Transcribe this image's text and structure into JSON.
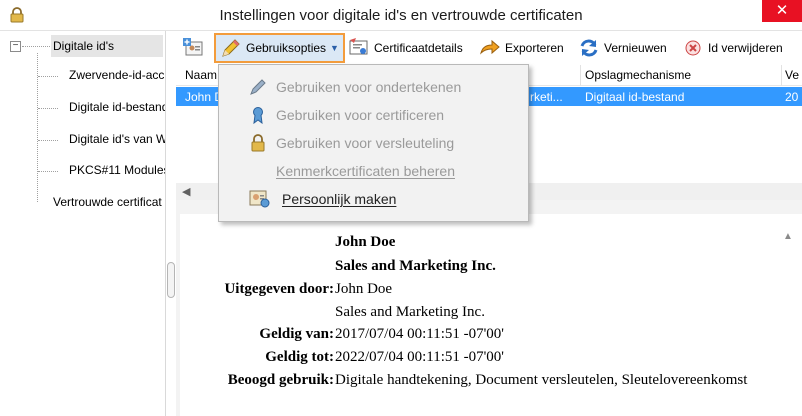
{
  "window": {
    "title": "Instellingen voor digitale id's en vertrouwde certificaten",
    "close_label": "✕"
  },
  "tree": {
    "toggle": "−",
    "root": "Digitale id's",
    "children": [
      "Zwervende-id-acc",
      "Digitale id-bestand",
      "Digitale id's van W",
      "PKCS#11 Modules"
    ],
    "trusted": "Vertrouwde certificat"
  },
  "toolbar": {
    "use_options": "Gebruiksopties",
    "cert_details": "Certificaatdetails",
    "export": "Exporteren",
    "refresh": "Vernieuwen",
    "remove_id": "Id verwijderen"
  },
  "table": {
    "columns": [
      "Naam",
      "Opslagmechanisme",
      "Ve"
    ],
    "row": {
      "name": "John D",
      "issuer_fragment": "rketi...",
      "storage": "Digitaal id-bestand",
      "version": "20"
    }
  },
  "menu": {
    "items": [
      {
        "label": "Gebruiken voor ondertekenen",
        "icon": "pen-icon",
        "enabled": false
      },
      {
        "label": "Gebruiken voor certificeren",
        "icon": "ribbon-icon",
        "enabled": false
      },
      {
        "label": "Gebruiken voor versleuteling",
        "icon": "lock-icon",
        "enabled": false
      },
      {
        "label": "Kenmerkcertificaten beheren",
        "icon": "",
        "enabled": false
      },
      {
        "label": "Persoonlijk maken",
        "icon": "personalize-icon",
        "enabled": true
      }
    ]
  },
  "details": {
    "name": "John Doe",
    "org": "Sales and Marketing Inc.",
    "issued_by_label": "Uitgegeven door:",
    "issued_by_name": "John Doe",
    "issued_by_org": "Sales and Marketing Inc.",
    "valid_from_label": "Geldig van:",
    "valid_from": "2017/07/04 00:11:51 -07'00'",
    "valid_to_label": "Geldig tot:",
    "valid_to": "2022/07/04 00:11:51 -07'00'",
    "intended_use_label": "Beoogd gebruik:",
    "intended_use": "Digitale handtekening, Document versleutelen, Sleutelovereenkomst"
  },
  "colors": {
    "selection": "#3399ff",
    "highlight_border": "#f39c3c",
    "close_button": "#e81123"
  }
}
